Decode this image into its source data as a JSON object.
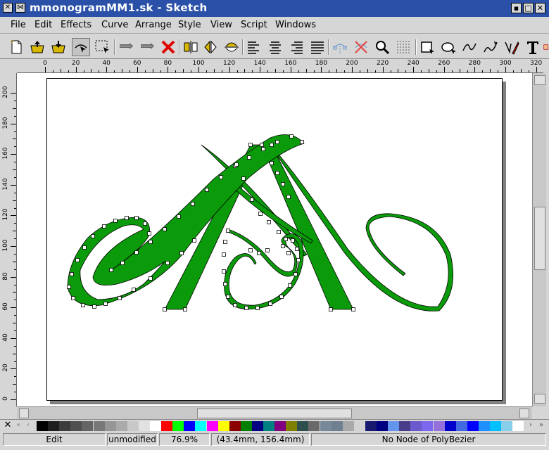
{
  "window": {
    "title": "mmonogramMM1.sk - Sketch"
  },
  "menu": [
    "File",
    "Edit",
    "Effects",
    "Curve",
    "Arrange",
    "Style",
    "View",
    "Script",
    "Windows"
  ],
  "toolbar": {
    "tools": [
      {
        "name": "new-file-icon"
      },
      {
        "name": "open-file-icon"
      },
      {
        "name": "save-file-icon"
      },
      {
        "name": "edit-tool-icon",
        "active": true
      },
      {
        "name": "select-tool-icon"
      },
      {
        "name": "undo-icon"
      },
      {
        "name": "redo-icon"
      },
      {
        "name": "delete-icon"
      },
      {
        "name": "flip-horizontal-icon"
      },
      {
        "name": "flip-vertical-icon"
      },
      {
        "name": "rotate-icon"
      },
      {
        "name": "align-left-icon"
      },
      {
        "name": "align-center-icon"
      },
      {
        "name": "align-right-icon"
      },
      {
        "name": "align-justify-icon"
      },
      {
        "name": "snap-nodes-icon"
      },
      {
        "name": "snap-off-icon"
      },
      {
        "name": "zoom-icon"
      },
      {
        "name": "grid-icon"
      },
      {
        "name": "rectangle-tool-icon"
      },
      {
        "name": "ellipse-tool-icon"
      },
      {
        "name": "bezier-tool-icon"
      },
      {
        "name": "freehand-tool-icon"
      },
      {
        "name": "pen-tool-icon"
      },
      {
        "name": "text-tool-icon"
      },
      {
        "name": "image-tool-icon"
      }
    ]
  },
  "ruler": {
    "h_labels": [
      "0",
      "20",
      "40",
      "60",
      "80",
      "100",
      "120",
      "140",
      "160",
      "180",
      "200",
      "220",
      "240",
      "260",
      "280",
      "300",
      "320"
    ],
    "v_labels": [
      "200",
      "180",
      "160",
      "140",
      "120",
      "100",
      "80",
      "60",
      "40",
      "20",
      "0"
    ]
  },
  "palette": {
    "colors": [
      "#000000",
      "#1e1e1e",
      "#3c3c3c",
      "#505050",
      "#646464",
      "#787878",
      "#969696",
      "#aaaaaa",
      "#c8c8c8",
      "#e1e1e1",
      "#ffffff",
      "#ff0000",
      "#00ff00",
      "#0000ff",
      "#00ffff",
      "#ff00ff",
      "#ffff00",
      "#8b0000",
      "#008000",
      "#000080",
      "#008080",
      "#800080",
      "#808000",
      "#2f4f4f",
      "#696969",
      "#778899",
      "#708090",
      "#a9a9a9",
      "#d3d3d3",
      "#191970",
      "#000080",
      "#6495ed",
      "#483d8b",
      "#6a5acd",
      "#7b68ee",
      "#9370db",
      "#0000cd",
      "#4169e1",
      "#0000ff",
      "#1e90ff",
      "#00bfff",
      "#87ceeb",
      "#ffffff"
    ]
  },
  "status": {
    "mode": "Edit",
    "modified": "unmodified",
    "zoom": "76.9%",
    "coords": "(43.4mm, 156.4mm)",
    "info": "No Node of PolyBezier"
  },
  "colors": {
    "titlebar": "#2a50a8",
    "shape_fill": "#0a9a0a",
    "node": "#ffffff"
  }
}
